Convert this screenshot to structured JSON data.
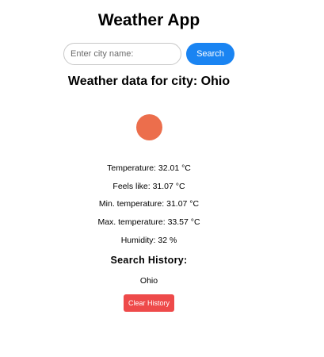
{
  "app": {
    "title": "Weather App"
  },
  "search": {
    "placeholder": "Enter city name:",
    "value": "",
    "button_label": "Search"
  },
  "weather": {
    "heading": "Weather data for city: Ohio",
    "icon": "weather-icon",
    "icon_color": "#ec6e4c",
    "temperature": "Temperature: 32.01 °C",
    "feels_like": "Feels like: 31.07 °C",
    "min_temperature": "Min. temperature: 31.07 °C",
    "max_temperature": "Max. temperature: 33.57 °C",
    "humidity": "Humidity: 32 %"
  },
  "history": {
    "heading": "Search History:",
    "items": [
      "Ohio"
    ],
    "clear_label": "Clear History"
  },
  "colors": {
    "primary_button": "#1a84f2",
    "danger_button": "#ee4a4a"
  }
}
